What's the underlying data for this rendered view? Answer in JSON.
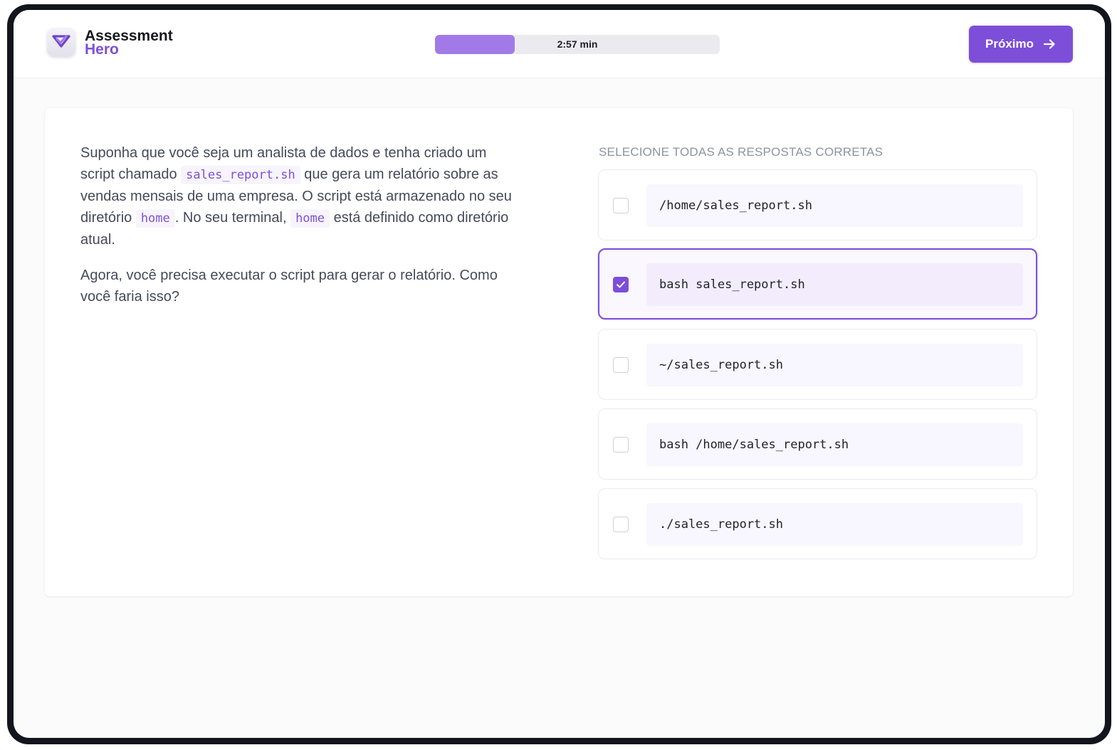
{
  "brand": {
    "name_line1": "Assessment",
    "name_line2": "Hero",
    "logo_icon": "heart-check-icon",
    "accent_color": "#7d4ed8"
  },
  "timer": {
    "label": "2:57 min",
    "progress_fraction": 0.28
  },
  "header": {
    "next_label": "Próximo",
    "next_icon": "arrow-right-icon"
  },
  "question": {
    "p1_part1": "Suponha que você seja um analista de dados e tenha criado um script chamado ",
    "p1_code1": "sales_report.sh",
    "p1_part2": " que gera um relatório sobre as vendas mensais de uma empresa. O script está armazenado no seu diretório ",
    "p1_code2": "home",
    "p1_part3": ". No seu terminal, ",
    "p1_code3": "home",
    "p1_part4": " está definido como diretório atual.",
    "p2": "Agora, você precisa executar o script para gerar o relatório. Como você faria isso?"
  },
  "answers": {
    "title": "SELECIONE TODAS AS RESPOSTAS CORRETAS",
    "options": [
      {
        "text": "/home/sales_report.sh",
        "checked": false
      },
      {
        "text": "bash sales_report.sh",
        "checked": true
      },
      {
        "text": "~/sales_report.sh",
        "checked": false
      },
      {
        "text": "bash /home/sales_report.sh",
        "checked": false
      },
      {
        "text": "./sales_report.sh",
        "checked": false
      }
    ]
  }
}
